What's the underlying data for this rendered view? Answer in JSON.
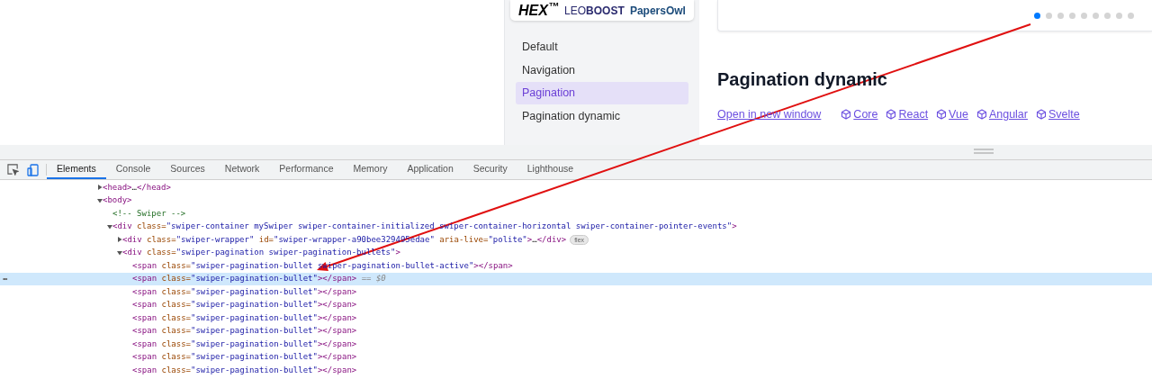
{
  "sidebar": {
    "logos": [
      "HEX$^{™}$",
      "LEO**BOOST**",
      "PapersOwl"
    ],
    "items": [
      {
        "label": "Default",
        "selected": false
      },
      {
        "label": "Navigation",
        "selected": false
      },
      {
        "label": "Pagination",
        "selected": true
      },
      {
        "label": "Pagination dynamic",
        "selected": false
      }
    ]
  },
  "slider": {
    "bullets": [
      {
        "selected": true
      },
      {
        "selected": false
      },
      {
        "selected": false
      },
      {
        "selected": false
      },
      {
        "selected": false
      },
      {
        "selected": false
      },
      {
        "selected": false
      },
      {
        "selected": false
      },
      {
        "selected": false
      }
    ]
  },
  "section": {
    "title": "Pagination dynamic",
    "open_link": "Open in new window",
    "framework_links": [
      "Core",
      "React",
      "Vue",
      "Angular",
      "Svelte"
    ]
  },
  "devtools": {
    "tabs": [
      {
        "label": "Elements",
        "selected": true
      },
      {
        "label": "Console",
        "selected": false
      },
      {
        "label": "Sources",
        "selected": false
      },
      {
        "label": "Network",
        "selected": false
      },
      {
        "label": "Performance",
        "selected": false
      },
      {
        "label": "Memory",
        "selected": false
      },
      {
        "label": "Application",
        "selected": false
      },
      {
        "label": "Security",
        "selected": false
      },
      {
        "label": "Lighthouse",
        "selected": false
      }
    ],
    "selected_marker": "•••",
    "tree": [
      {
        "expanded": false,
        "selected": false,
        "tokens": [
          {
            "kind": "tag",
            "text": "<head>"
          },
          {
            "kind": "text",
            "text": "…"
          },
          {
            "kind": "tag",
            "text": "</head>"
          }
        ]
      },
      {
        "expanded": true,
        "selected": false,
        "tokens": [
          {
            "kind": "tag",
            "text": "<body>"
          }
        ],
        "children": [
          {
            "selected": false,
            "tokens": [
              {
                "kind": "comment",
                "text": "<!-- Swiper -->"
              }
            ]
          },
          {
            "expanded": true,
            "selected": false,
            "tokens": [
              {
                "kind": "tag",
                "text": "<div"
              },
              {
                "kind": "attr",
                "text": " class="
              },
              {
                "kind": "value",
                "text": "\"swiper-container mySwiper swiper-container-initialized swiper-container-horizontal swiper-container-pointer-events\""
              },
              {
                "kind": "tag",
                "text": ">"
              }
            ],
            "children": [
              {
                "expanded": false,
                "selected": false,
                "badge": "flex",
                "tokens": [
                  {
                    "kind": "tag",
                    "text": "<div"
                  },
                  {
                    "kind": "attr",
                    "text": " class="
                  },
                  {
                    "kind": "value",
                    "text": "\"swiper-wrapper\""
                  },
                  {
                    "kind": "attr",
                    "text": " id="
                  },
                  {
                    "kind": "value",
                    "text": "\"swiper-wrapper-a90bee329495edae\""
                  },
                  {
                    "kind": "attr",
                    "text": " aria-live="
                  },
                  {
                    "kind": "value",
                    "text": "\"polite\""
                  },
                  {
                    "kind": "tag",
                    "text": ">"
                  },
                  {
                    "kind": "text",
                    "text": "…"
                  },
                  {
                    "kind": "tag",
                    "text": "</div>"
                  }
                ]
              },
              {
                "expanded": true,
                "selected": false,
                "tokens": [
                  {
                    "kind": "tag",
                    "text": "<div"
                  },
                  {
                    "kind": "attr",
                    "text": " class="
                  },
                  {
                    "kind": "value",
                    "text": "\"swiper-pagination swiper-pagination-bullets\""
                  },
                  {
                    "kind": "tag",
                    "text": ">"
                  }
                ],
                "children": [
                  {
                    "selected": false,
                    "tokens": [
                      {
                        "kind": "tag",
                        "text": "<span"
                      },
                      {
                        "kind": "attr",
                        "text": " class="
                      },
                      {
                        "kind": "value",
                        "text": "\"swiper-pagination-bullet swiper-pagination-bullet-active\""
                      },
                      {
                        "kind": "tag",
                        "text": "></span>"
                      }
                    ]
                  },
                  {
                    "selected": true,
                    "suffix": " == $0",
                    "tokens": [
                      {
                        "kind": "tag",
                        "text": "<span"
                      },
                      {
                        "kind": "attr",
                        "text": " class="
                      },
                      {
                        "kind": "value",
                        "text": "\"swiper-pagination-bullet\""
                      },
                      {
                        "kind": "tag",
                        "text": "></span>"
                      }
                    ]
                  },
                  {
                    "selected": false,
                    "tokens": [
                      {
                        "kind": "tag",
                        "text": "<span"
                      },
                      {
                        "kind": "attr",
                        "text": " class="
                      },
                      {
                        "kind": "value",
                        "text": "\"swiper-pagination-bullet\""
                      },
                      {
                        "kind": "tag",
                        "text": "></span>"
                      }
                    ]
                  },
                  {
                    "selected": false,
                    "tokens": [
                      {
                        "kind": "tag",
                        "text": "<span"
                      },
                      {
                        "kind": "attr",
                        "text": " class="
                      },
                      {
                        "kind": "value",
                        "text": "\"swiper-pagination-bullet\""
                      },
                      {
                        "kind": "tag",
                        "text": "></span>"
                      }
                    ]
                  },
                  {
                    "selected": false,
                    "tokens": [
                      {
                        "kind": "tag",
                        "text": "<span"
                      },
                      {
                        "kind": "attr",
                        "text": " class="
                      },
                      {
                        "kind": "value",
                        "text": "\"swiper-pagination-bullet\""
                      },
                      {
                        "kind": "tag",
                        "text": "></span>"
                      }
                    ]
                  },
                  {
                    "selected": false,
                    "tokens": [
                      {
                        "kind": "tag",
                        "text": "<span"
                      },
                      {
                        "kind": "attr",
                        "text": " class="
                      },
                      {
                        "kind": "value",
                        "text": "\"swiper-pagination-bullet\""
                      },
                      {
                        "kind": "tag",
                        "text": "></span>"
                      }
                    ]
                  },
                  {
                    "selected": false,
                    "tokens": [
                      {
                        "kind": "tag",
                        "text": "<span"
                      },
                      {
                        "kind": "attr",
                        "text": " class="
                      },
                      {
                        "kind": "value",
                        "text": "\"swiper-pagination-bullet\""
                      },
                      {
                        "kind": "tag",
                        "text": "></span>"
                      }
                    ]
                  },
                  {
                    "selected": false,
                    "tokens": [
                      {
                        "kind": "tag",
                        "text": "<span"
                      },
                      {
                        "kind": "attr",
                        "text": " class="
                      },
                      {
                        "kind": "value",
                        "text": "\"swiper-pagination-bullet\""
                      },
                      {
                        "kind": "tag",
                        "text": "></span>"
                      }
                    ]
                  },
                  {
                    "selected": false,
                    "tokens": [
                      {
                        "kind": "tag",
                        "text": "<span"
                      },
                      {
                        "kind": "attr",
                        "text": " class="
                      },
                      {
                        "kind": "value",
                        "text": "\"swiper-pagination-bullet\""
                      },
                      {
                        "kind": "tag",
                        "text": "></span>"
                      }
                    ]
                  }
                ]
              }
            ]
          }
        ]
      }
    ]
  }
}
